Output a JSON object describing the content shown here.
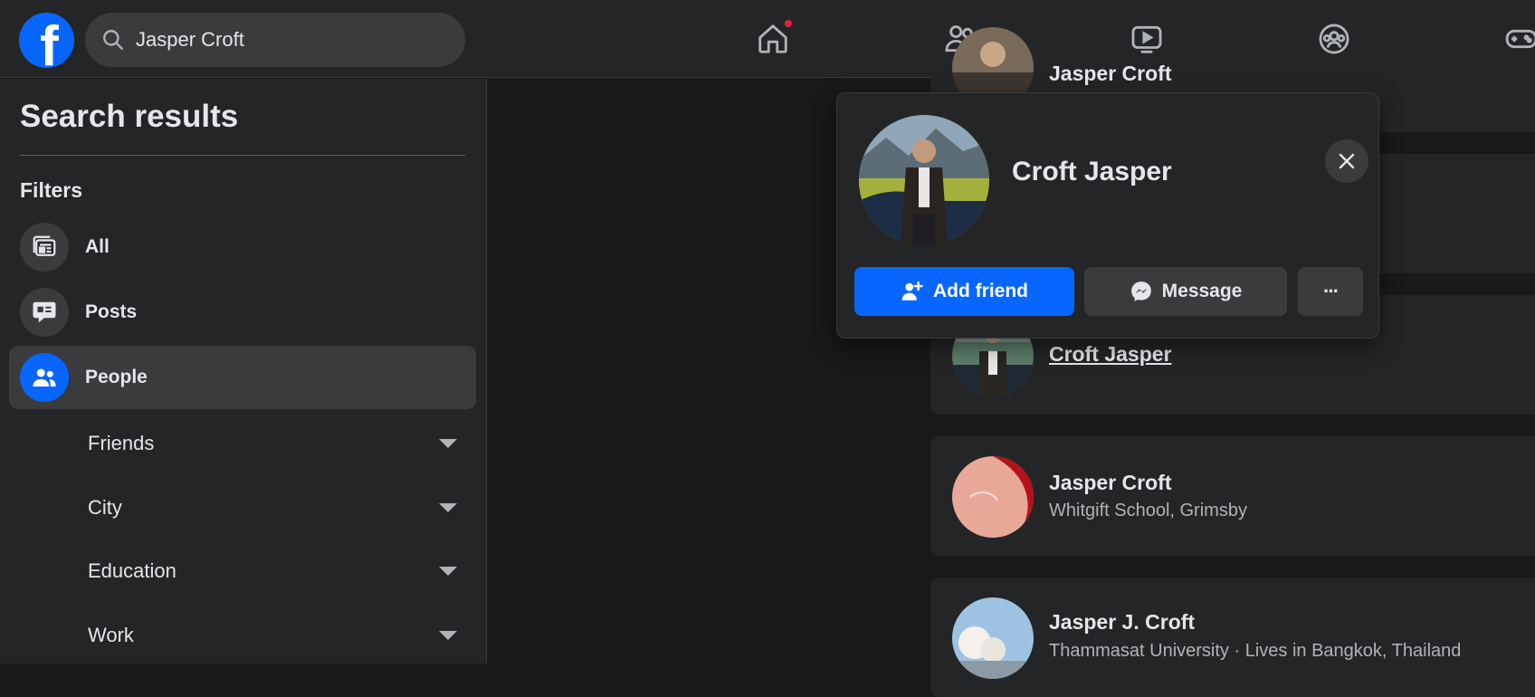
{
  "topbar": {
    "logo_letter": "f",
    "search": {
      "value": "Jasper Croft",
      "icon": "search-icon"
    },
    "nav": [
      {
        "name": "home",
        "icon": "home-icon",
        "has_notification": true
      },
      {
        "name": "friends",
        "icon": "friends-icon"
      },
      {
        "name": "watch",
        "icon": "video-icon"
      },
      {
        "name": "groups",
        "icon": "groups-icon"
      },
      {
        "name": "gaming",
        "icon": "gamepad-icon"
      }
    ]
  },
  "sidebar": {
    "title": "Search results",
    "filters_heading": "Filters",
    "filters": [
      {
        "label": "All",
        "icon": "all-results-icon",
        "active": false
      },
      {
        "label": "Posts",
        "icon": "posts-icon",
        "active": false
      },
      {
        "label": "People",
        "icon": "people-icon",
        "active": true
      }
    ],
    "sub_filters": [
      {
        "label": "Friends"
      },
      {
        "label": "City"
      },
      {
        "label": "Education"
      },
      {
        "label": "Work"
      }
    ]
  },
  "results": [
    {
      "name": "Jasper Croft",
      "subtitle": ""
    },
    {
      "name": "Croft Jasper",
      "subtitle": ""
    },
    {
      "name": "Jasper Croft",
      "subtitle": "Whitgift School, Grimsby"
    },
    {
      "name": "Jasper J. Croft",
      "subtitle": "Thammasat University · Lives in Bangkok, Thailand"
    }
  ],
  "hovercard": {
    "name": "Croft Jasper",
    "add_friend_label": "Add friend",
    "message_label": "Message",
    "more_label": "···"
  },
  "colors": {
    "accent": "#0866ff",
    "background": "#18191a",
    "surface": "#242526",
    "notification": "#e41e3f"
  }
}
